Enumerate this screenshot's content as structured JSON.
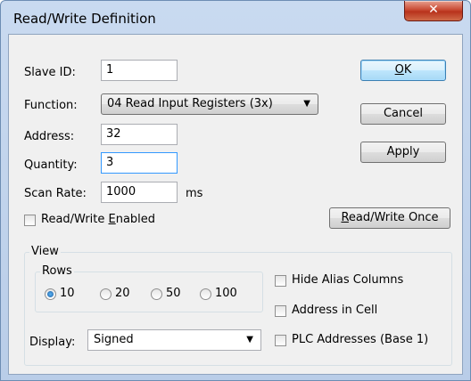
{
  "window": {
    "title": "Read/Write Definition",
    "close_glyph": "✕"
  },
  "form": {
    "slave_id": {
      "label": "Slave ID:",
      "value": "1"
    },
    "function": {
      "label": "Function:",
      "value": "04 Read Input Registers (3x)"
    },
    "address": {
      "label": "Address:",
      "value": "32"
    },
    "quantity": {
      "label": "Quantity:",
      "value": "3"
    },
    "scan_rate": {
      "label": "Scan Rate:",
      "value": "1000",
      "unit": "ms"
    },
    "rw_enabled": {
      "label_pre": "Read/Write ",
      "label_accel": "E",
      "label_post": "nabled",
      "checked": false
    }
  },
  "buttons": {
    "ok": {
      "accel": "O",
      "rest": "K"
    },
    "cancel": "Cancel",
    "apply": "Apply",
    "rw_once": {
      "accel": "R",
      "rest": "ead/Write Once"
    }
  },
  "view": {
    "label": "View",
    "rows": {
      "label": "Rows",
      "options": [
        "10",
        "20",
        "50",
        "100"
      ],
      "selected": "10"
    },
    "display": {
      "label": "Display:",
      "value": "Signed"
    },
    "hide_alias": {
      "label": "Hide Alias Columns",
      "checked": false
    },
    "address_in_cell": {
      "label": "Address in Cell",
      "checked": false
    },
    "plc_addresses": {
      "label": "PLC Addresses (Base 1)",
      "checked": false
    }
  },
  "icons": {
    "dropdown": "chevron-down-icon",
    "close": "close-icon"
  }
}
